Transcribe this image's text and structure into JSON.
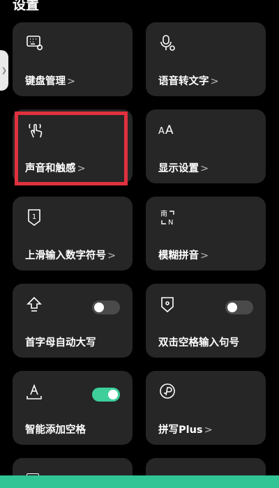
{
  "page": {
    "title": "设置"
  },
  "tiles": [
    {
      "label": "键盘管理",
      "chevron": ">",
      "icon": "keyboard-settings-icon"
    },
    {
      "label": "语音转文字",
      "chevron": ">",
      "icon": "microphone-settings-icon"
    },
    {
      "label": "声音和触感",
      "chevron": ">",
      "icon": "touch-vibrate-icon"
    },
    {
      "label": "显示设置",
      "chevron": ">",
      "icon": "font-size-icon",
      "icon_text": "AA"
    },
    {
      "label": "上滑输入数字符号",
      "chevron": ">",
      "icon": "swipe-number-icon",
      "icon_text": "1"
    },
    {
      "label": "模糊拼音",
      "chevron": ">",
      "icon": "fuzzy-pinyin-icon",
      "icon_text": "南N"
    },
    {
      "label": "首字母自动大写",
      "icon": "capitalize-icon",
      "toggle_on": false
    },
    {
      "label": "双击空格输入句号",
      "icon": "period-shield-icon",
      "toggle_on": false
    },
    {
      "label": "智能添加空格",
      "icon": "space-icon",
      "toggle_on": true
    },
    {
      "label": "拼写Plus",
      "chevron": ">",
      "icon": "spell-plus-icon"
    }
  ],
  "colors": {
    "toggle_on": "#3ecf9b",
    "highlight": "#e0313e",
    "tile_bg": "#262626"
  }
}
